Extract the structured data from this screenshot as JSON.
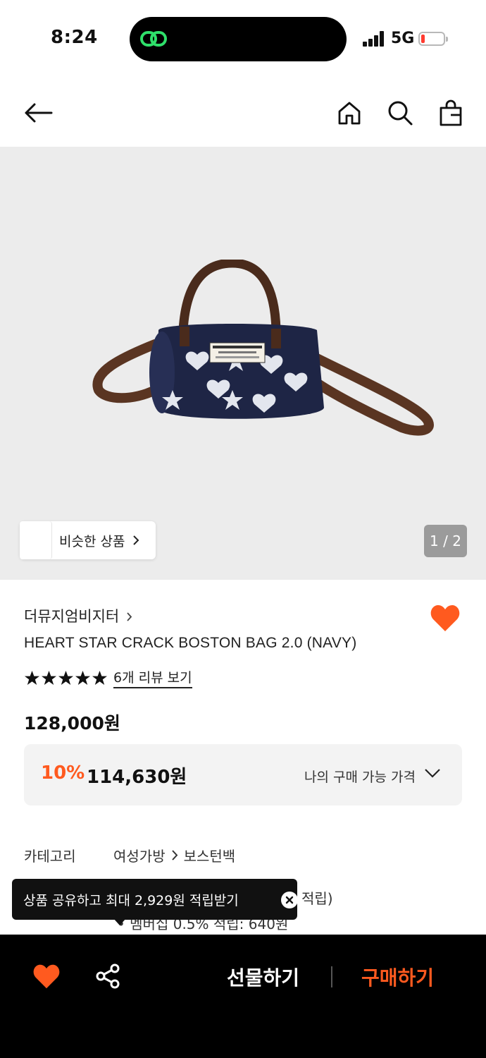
{
  "status": {
    "time": "8:24",
    "network": "5G",
    "battery_color": "#ff3b30",
    "island_icon": "link-icon"
  },
  "nav": {
    "back_icon": "back-arrow-icon",
    "home_icon": "home-icon",
    "search_icon": "search-icon",
    "bag_icon": "shopping-bag-icon"
  },
  "gallery": {
    "similar_label": "비슷한 상품",
    "page_indicator": "1 / 2",
    "current_page": 1,
    "total_pages": 2
  },
  "product": {
    "brand": "더뮤지엄비지터",
    "name": "HEART STAR CRACK BOSTON BAG 2.0 (NAVY)",
    "rating_stars": 5,
    "review_link": "6개 리뷰 보기",
    "price": "128,000원",
    "discount_rate": "10%",
    "discount_price": "114,630원",
    "my_price_label": "나의 구매 가능 가격",
    "wishlisted": true
  },
  "info": {
    "category_label": "카테고리",
    "category_1": "여성가방",
    "category_2": "보스턴백",
    "points_line1": "적립)",
    "points_line2": "멤버십 0.5% 적립: 640원"
  },
  "tooltip": {
    "text": "상품 공유하고 최대 2,929원 적립받기"
  },
  "bottom": {
    "gift_label": "선물하기",
    "buy_label": "구매하기"
  },
  "colors": {
    "accent": "#ff5a1f",
    "bottom_bar": "#000000",
    "hero_bg": "#ececec"
  }
}
